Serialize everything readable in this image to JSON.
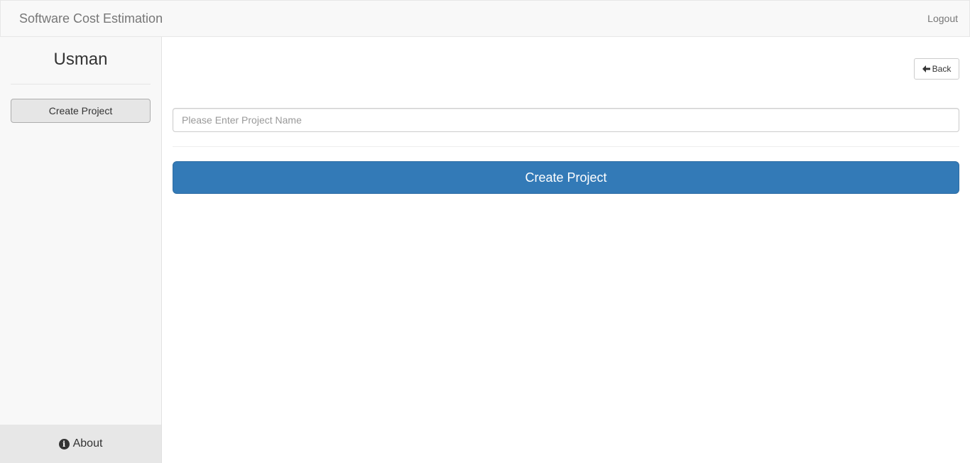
{
  "navbar": {
    "brand": "Software Cost Estimation",
    "logout_label": "Logout"
  },
  "sidebar": {
    "user_name": "Usman",
    "create_project_label": "Create Project",
    "about_label": "About",
    "about_icon": "info-circle-icon"
  },
  "main": {
    "back_label": "Back",
    "back_icon": "arrow-left-icon",
    "project_name_placeholder": "Please Enter Project Name",
    "project_name_value": "",
    "create_project_label": "Create Project"
  },
  "colors": {
    "primary": "#337ab7",
    "navbar_bg": "#f8f8f8",
    "sidebar_bg": "#f8f8f8",
    "about_bg": "#e7e7e7"
  }
}
